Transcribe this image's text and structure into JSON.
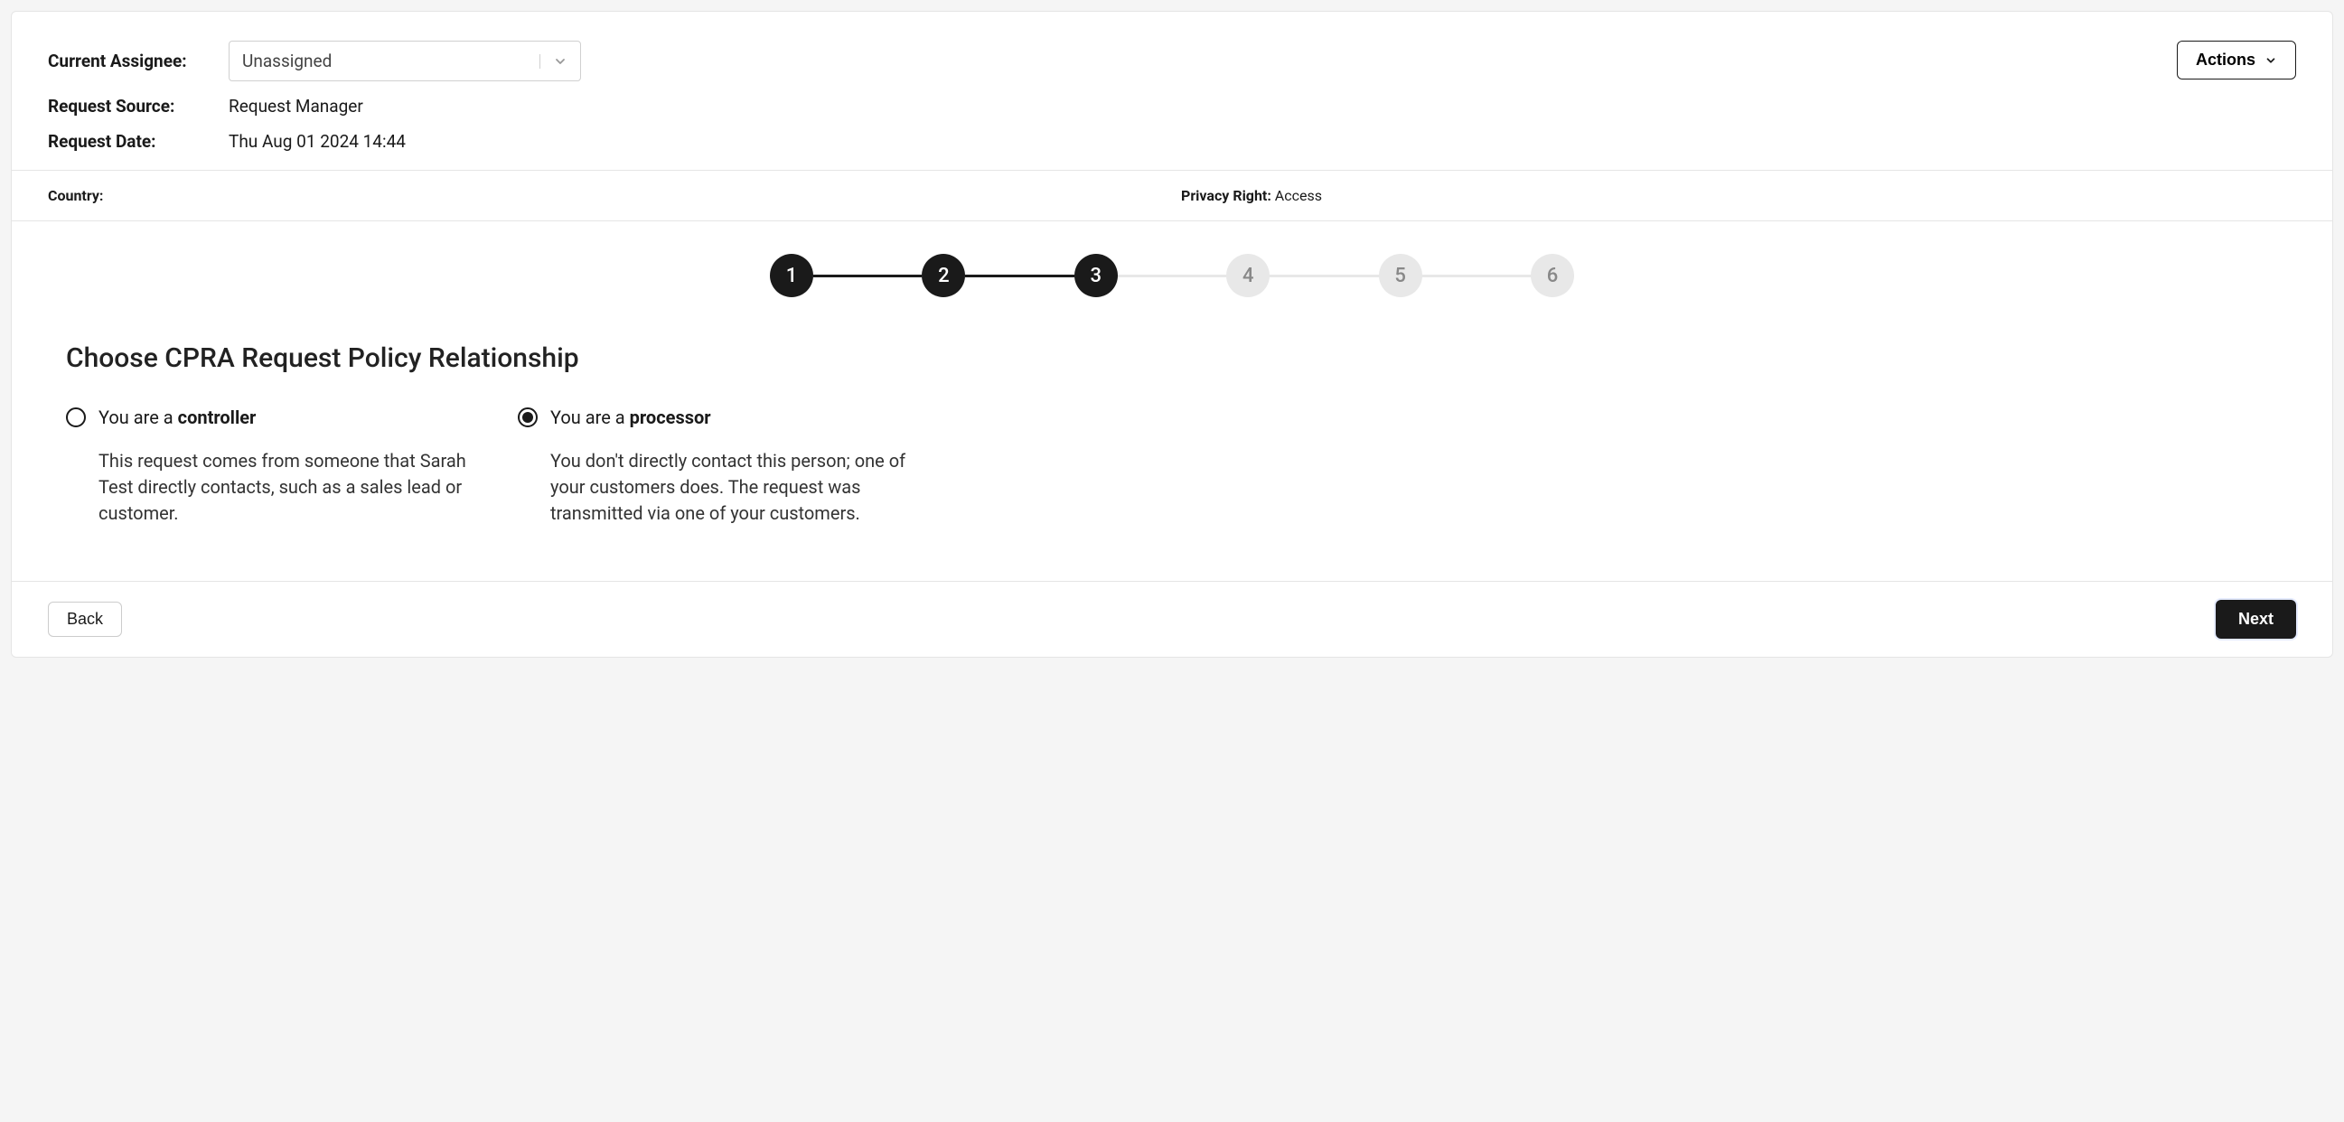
{
  "header": {
    "assignee_label": "Current Assignee:",
    "assignee_value": "Unassigned",
    "source_label": "Request Source:",
    "source_value": "Request Manager",
    "date_label": "Request Date:",
    "date_value": "Thu Aug 01 2024 14:44",
    "actions_label": "Actions"
  },
  "meta": {
    "country_label": "Country:",
    "country_value": "",
    "privacy_right_label": "Privacy Right:",
    "privacy_right_value": "Access"
  },
  "stepper": {
    "steps": [
      "1",
      "2",
      "3",
      "4",
      "5",
      "6"
    ],
    "current": 3
  },
  "main": {
    "heading": "Choose CPRA Request Policy Relationship",
    "options": [
      {
        "title_prefix": "You are a ",
        "title_bold": "controller",
        "desc": "This request comes from someone that Sarah Test directly contacts, such as a sales lead or customer.",
        "selected": false
      },
      {
        "title_prefix": "You are a ",
        "title_bold": "processor",
        "desc": "You don't directly contact this person; one of your customers does. The request was transmitted via one of your customers.",
        "selected": true
      }
    ]
  },
  "footer": {
    "back_label": "Back",
    "next_label": "Next"
  }
}
